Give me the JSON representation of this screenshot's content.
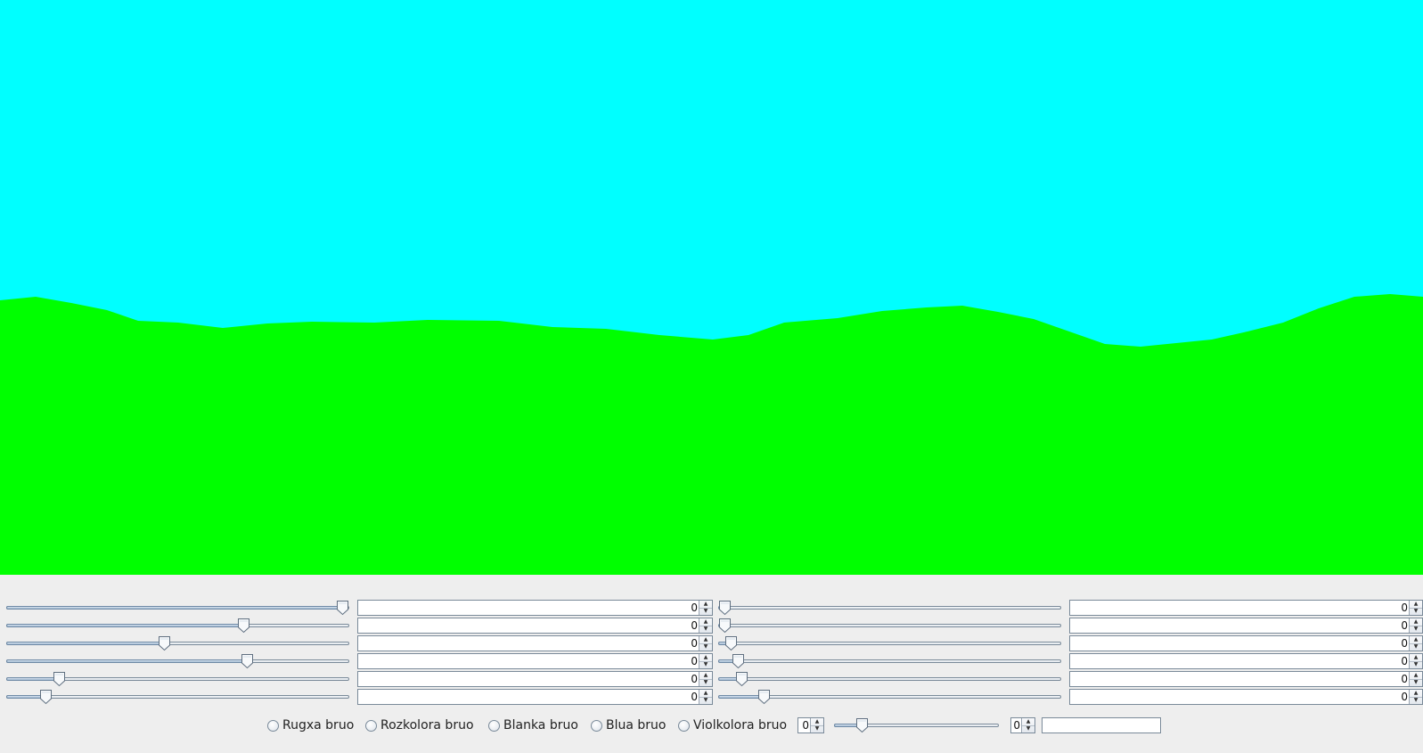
{
  "scene": {
    "sky_color": "#00ffff",
    "ground_color": "#00ff00"
  },
  "left_rows": [
    {
      "slider_value": 1.0,
      "spinner_value": "0"
    },
    {
      "slider_value": 0.7,
      "spinner_value": "0"
    },
    {
      "slider_value": 0.46,
      "spinner_value": "0"
    },
    {
      "slider_value": 0.71,
      "spinner_value": "0"
    },
    {
      "slider_value": 0.14,
      "spinner_value": "0"
    },
    {
      "slider_value": 0.1,
      "spinner_value": "0"
    }
  ],
  "right_rows": [
    {
      "slider_value": 0.0,
      "spinner_value": "0"
    },
    {
      "slider_value": 0.0,
      "spinner_value": "0"
    },
    {
      "slider_value": 0.02,
      "spinner_value": "0"
    },
    {
      "slider_value": 0.04,
      "spinner_value": "0"
    },
    {
      "slider_value": 0.05,
      "spinner_value": "0"
    },
    {
      "slider_value": 0.12,
      "spinner_value": "0"
    }
  ],
  "noise_options": [
    {
      "label": "Rugxa bruo",
      "selected": false
    },
    {
      "label": "Rozkolora bruo",
      "selected": false
    },
    {
      "label": "Blanka bruo",
      "selected": false
    },
    {
      "label": "Blua bruo",
      "selected": false
    },
    {
      "label": "Violkolora bruo",
      "selected": false
    }
  ],
  "bottom": {
    "spinner1_value": "0",
    "slider_value": 0.14,
    "spinner2_value": "0",
    "text_value": ""
  },
  "icons": {
    "spinner_up": "up-arrow-icon",
    "spinner_down": "down-arrow-icon"
  }
}
